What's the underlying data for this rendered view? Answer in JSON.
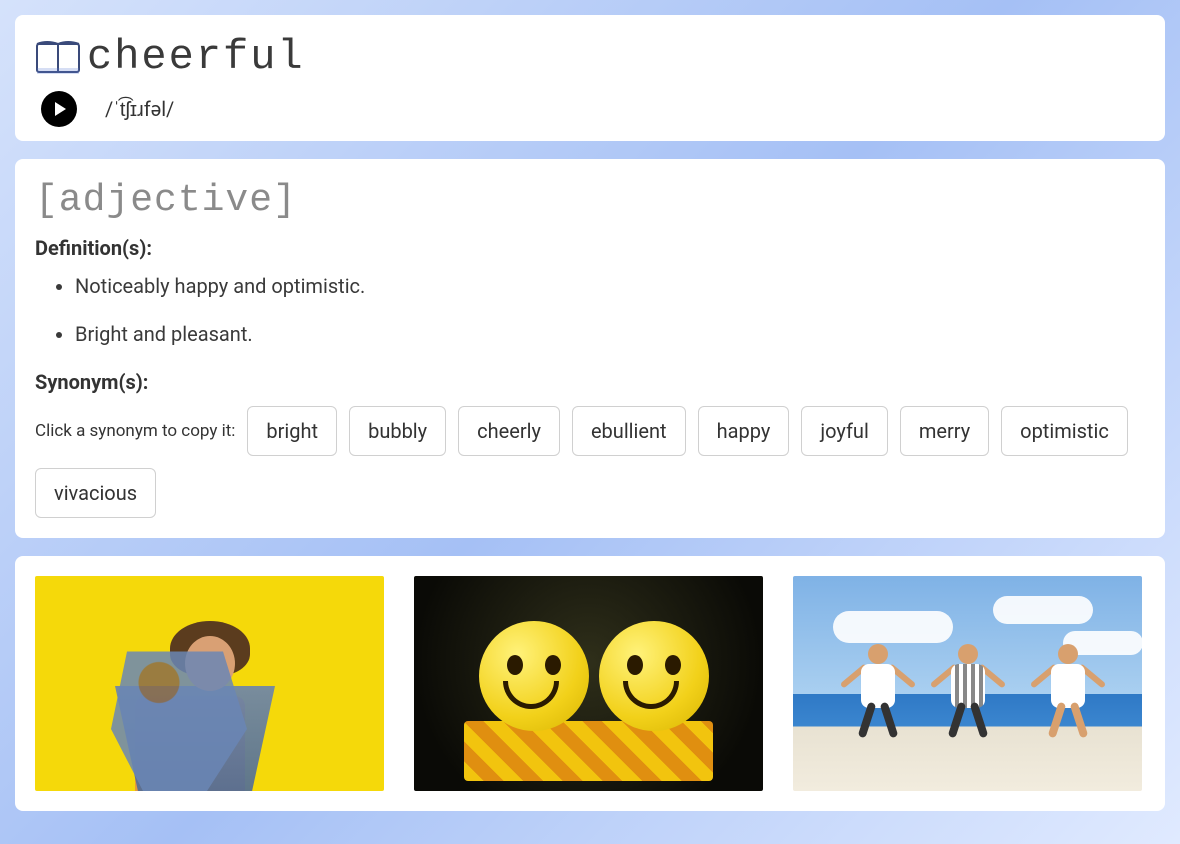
{
  "word": "cheerful",
  "phonetic": "/ˈt͡ʃɪɹfəl/",
  "part_of_speech": "[adjective]",
  "definitions_label": "Definition(s):",
  "definitions": [
    "Noticeably happy and optimistic.",
    "Bright and pleasant."
  ],
  "synonyms_label": "Synonym(s):",
  "synonyms_hint": "Click a synonym to copy it:",
  "synonyms": [
    "bright",
    "bubbly",
    "cheerly",
    "ebullient",
    "happy",
    "joyful",
    "merry",
    "optimistic",
    "vivacious"
  ]
}
